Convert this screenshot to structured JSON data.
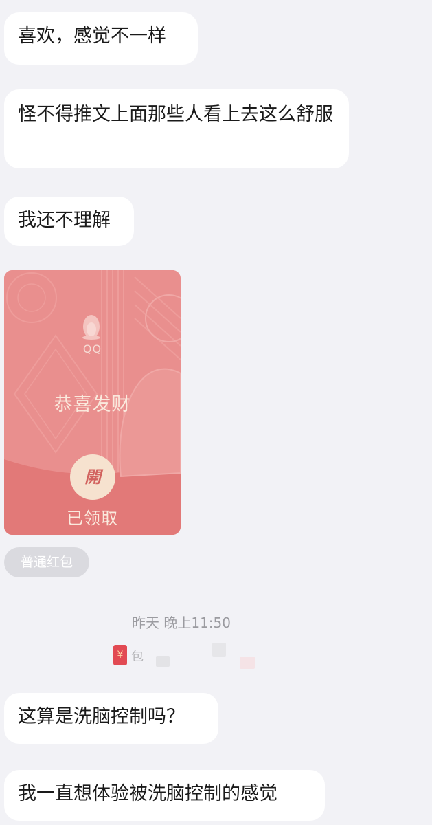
{
  "messages": [
    {
      "text": "喜欢，感觉不一样"
    },
    {
      "text": "怪不得推文上面那些人看上去这么舒服"
    },
    {
      "text": "我还不理解"
    },
    {
      "text": "这算是洗脑控制吗？"
    },
    {
      "text": "我一直想体验被洗脑控制的感觉"
    }
  ],
  "red_packet": {
    "brand": "QQ",
    "greeting": "恭喜发财",
    "open_label": "開",
    "status": "已领取",
    "type_label": "普通红包",
    "icon": "penguin-icon"
  },
  "timestamp": "昨天 晚上11:50",
  "system_notice": {
    "icon": "red-envelope-icon",
    "icon_glyph": "¥",
    "text": "包"
  },
  "colors": {
    "background": "#f2f2f6",
    "bubble": "#ffffff",
    "red_packet": "#e98f8e",
    "red_packet_bottom": "#e27978",
    "open_button": "#f6e2cf"
  }
}
